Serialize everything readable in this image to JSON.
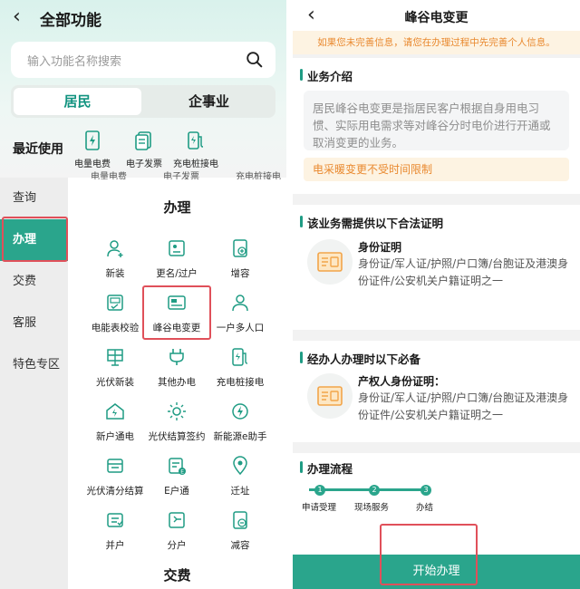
{
  "left": {
    "title": "全部功能",
    "search_placeholder": "输入功能名称搜索",
    "tabs": [
      "居民",
      "企事业"
    ],
    "recent_label": "最近使用",
    "recent": [
      "电量电费",
      "电子发票",
      "充电桩接电"
    ],
    "cut_row_text": "电量电费　　　　电子发票　　　　充电桩接电",
    "sidebar": [
      "查询",
      "办理",
      "交费",
      "客服",
      "特色专区"
    ],
    "section_main": "办理",
    "items": [
      "新装",
      "更名/过户",
      "增容",
      "电能表校验",
      "峰谷电变更",
      "一户多人口",
      "光伏新装",
      "其他办电",
      "充电桩接电",
      "新户通电",
      "光伏结算签约",
      "新能源e助手",
      "光伏清分结算",
      "E户通",
      "迁址",
      "并户",
      "分户",
      "减容"
    ],
    "section_next": "交费"
  },
  "right": {
    "title": "峰谷电变更",
    "notice": "如果您未完善信息，请您在办理过程中先完善个人信息。",
    "intro_title": "业务介绍",
    "intro_text": "居民峰谷电变更是指居民客户根据自身用电习惯、实际用电需求等对峰谷分时电价进行开通或取消变更的业务。",
    "warn": "电采暖变更不受时间限制",
    "proof_title": "该业务需提供以下合法证明",
    "proof_name": "身份证明",
    "proof_desc": "身份证/军人证/护照/户口簿/台胞证及港澳身份证件/公安机关户籍证明之一",
    "agent_title": "经办人办理时以下必备",
    "agent_name": "产权人身份证明：",
    "agent_desc": "身份证/军人证/护照/户口簿/台胞证及港澳身份证件/公安机关户籍证明之一",
    "flow_title": "办理流程",
    "steps": [
      {
        "num": "1",
        "label": "申请受理"
      },
      {
        "num": "2",
        "label": "现场服务"
      },
      {
        "num": "3",
        "label": "办结"
      }
    ],
    "start_button": "开始办理"
  },
  "colors": {
    "accent": "#2aa58c",
    "warning": "#e9892f",
    "highlight": "#e0505a"
  }
}
